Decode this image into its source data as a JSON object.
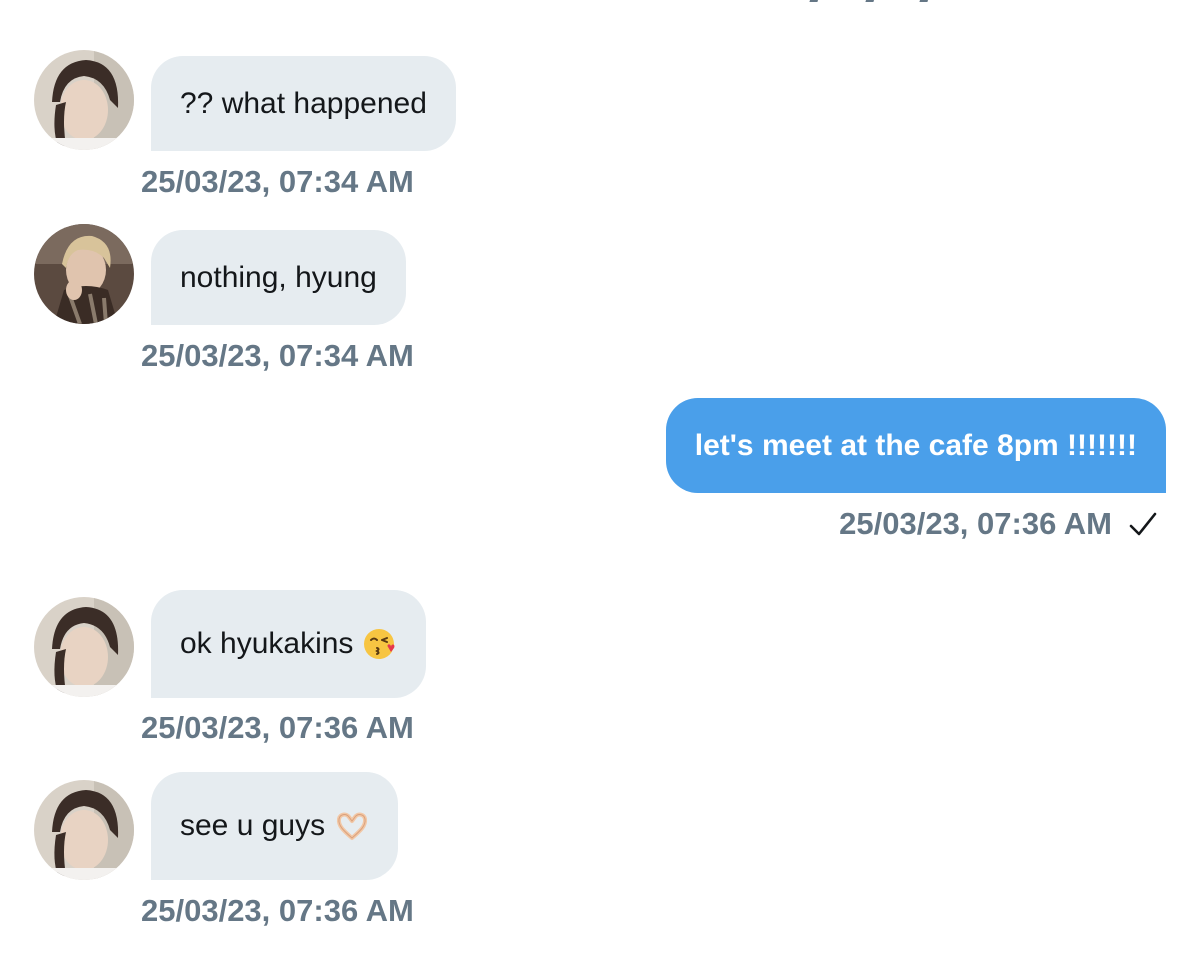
{
  "messages": [
    {
      "direction": "incoming",
      "text": "?? what happened",
      "time": "25/03/23, 07:34 AM",
      "avatar": "avatar-a"
    },
    {
      "direction": "incoming",
      "text": "nothing, hyung",
      "time": "25/03/23, 07:34 AM",
      "avatar": "avatar-b"
    },
    {
      "direction": "outgoing",
      "text": "let's meet at the cafe 8pm !!!!!!!",
      "time": "25/03/23, 07:36 AM",
      "status_icon": "checkmark-icon"
    },
    {
      "direction": "incoming",
      "text": "ok hyukakins",
      "emoji": "face-blowing-kiss",
      "time": "25/03/23, 07:36 AM",
      "avatar": "avatar-a"
    },
    {
      "direction": "incoming",
      "text": "see u guys",
      "emoji": "heart-hands",
      "time": "25/03/23, 07:36 AM",
      "avatar": "avatar-a"
    }
  ],
  "colors": {
    "incoming_bubble": "#e6ecf0",
    "outgoing_bubble": "#4a9fea",
    "timestamp": "#657786",
    "text": "#14171a"
  }
}
